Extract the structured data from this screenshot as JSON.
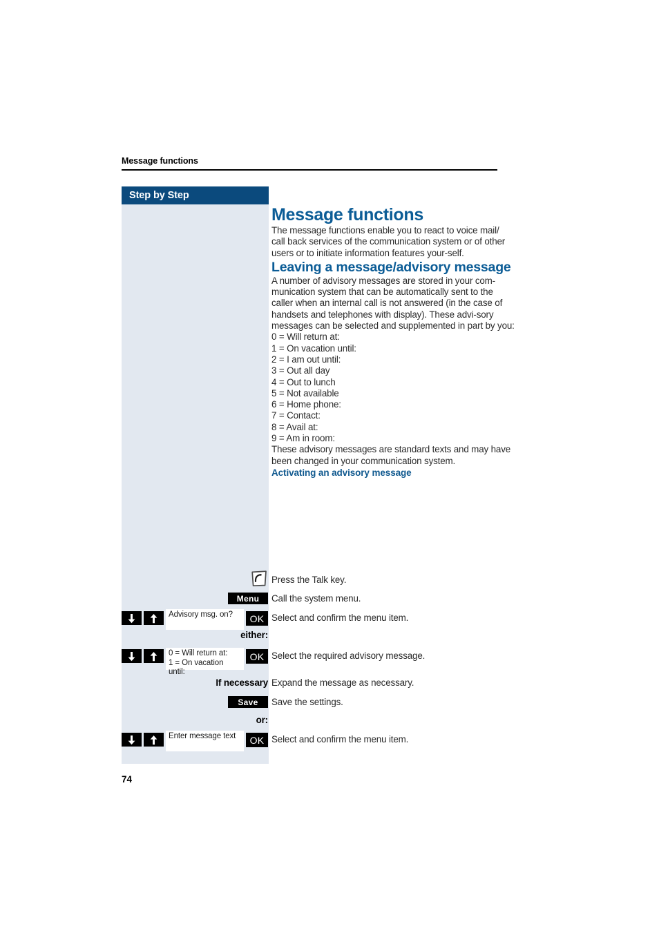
{
  "document": {
    "running_head": "Message functions",
    "page_number": "74"
  },
  "sidebar": {
    "header_label": "Step by Step"
  },
  "main": {
    "title": "Message functions",
    "intro": "The message functions enable you to react to voice mail/ call back services of the communication system or of other users or to initiate information features your-self.",
    "section_title": "Leaving a message/advisory message",
    "section_intro": "A number of advisory messages are stored in your com-munication system that can be automatically sent to the caller when an internal call is not answered (in the case of handsets and telephones with display). These advi-sory messages can be selected and supplemented in part by you:",
    "advisory_messages": [
      "0 = Will return at:",
      "1 = On vacation until:",
      "2 = I am out until:",
      "3 = Out all day",
      "4 = Out to lunch",
      "5 = Not available",
      "6 = Home phone:",
      "7 = Contact:",
      "8 = Avail at:",
      "9 = Am in room:"
    ],
    "closing_note": "These advisory messages are standard texts and may have been changed in your communication system.",
    "procedure_heading": "Activating an advisory message"
  },
  "steps": [
    {
      "id": "talk",
      "icon": "talk-key-icon",
      "instruction": "Press the Talk key."
    },
    {
      "id": "menu",
      "button_label": "Menu",
      "instruction": "Call the system menu."
    },
    {
      "id": "advisory-on",
      "display_lines": [
        "Advisory msg. on?"
      ],
      "confirm_label": "OK",
      "instruction": "Select and confirm the menu item."
    },
    {
      "id": "either",
      "cue": "either:"
    },
    {
      "id": "select-message",
      "display_lines": [
        "0 = Will return at:",
        "1 = On vacation until:"
      ],
      "confirm_label": "OK",
      "instruction": "Select the required advisory message."
    },
    {
      "id": "if-necessary",
      "cue": "If necessary",
      "instruction": "Expand the message as necessary."
    },
    {
      "id": "save",
      "button_label": "Save",
      "instruction": "Save the settings."
    },
    {
      "id": "or",
      "cue": "or:"
    },
    {
      "id": "enter-text",
      "display_lines": [
        "Enter message text"
      ],
      "confirm_label": "OK",
      "instruction": "Select and confirm the menu item."
    }
  ],
  "colors": {
    "heading_blue": "#0b5c96",
    "bar_blue": "#0b4a7d",
    "sidebar_bg": "#e2e8f0",
    "key_black": "#000000",
    "body_text": "#2a2a2a"
  }
}
